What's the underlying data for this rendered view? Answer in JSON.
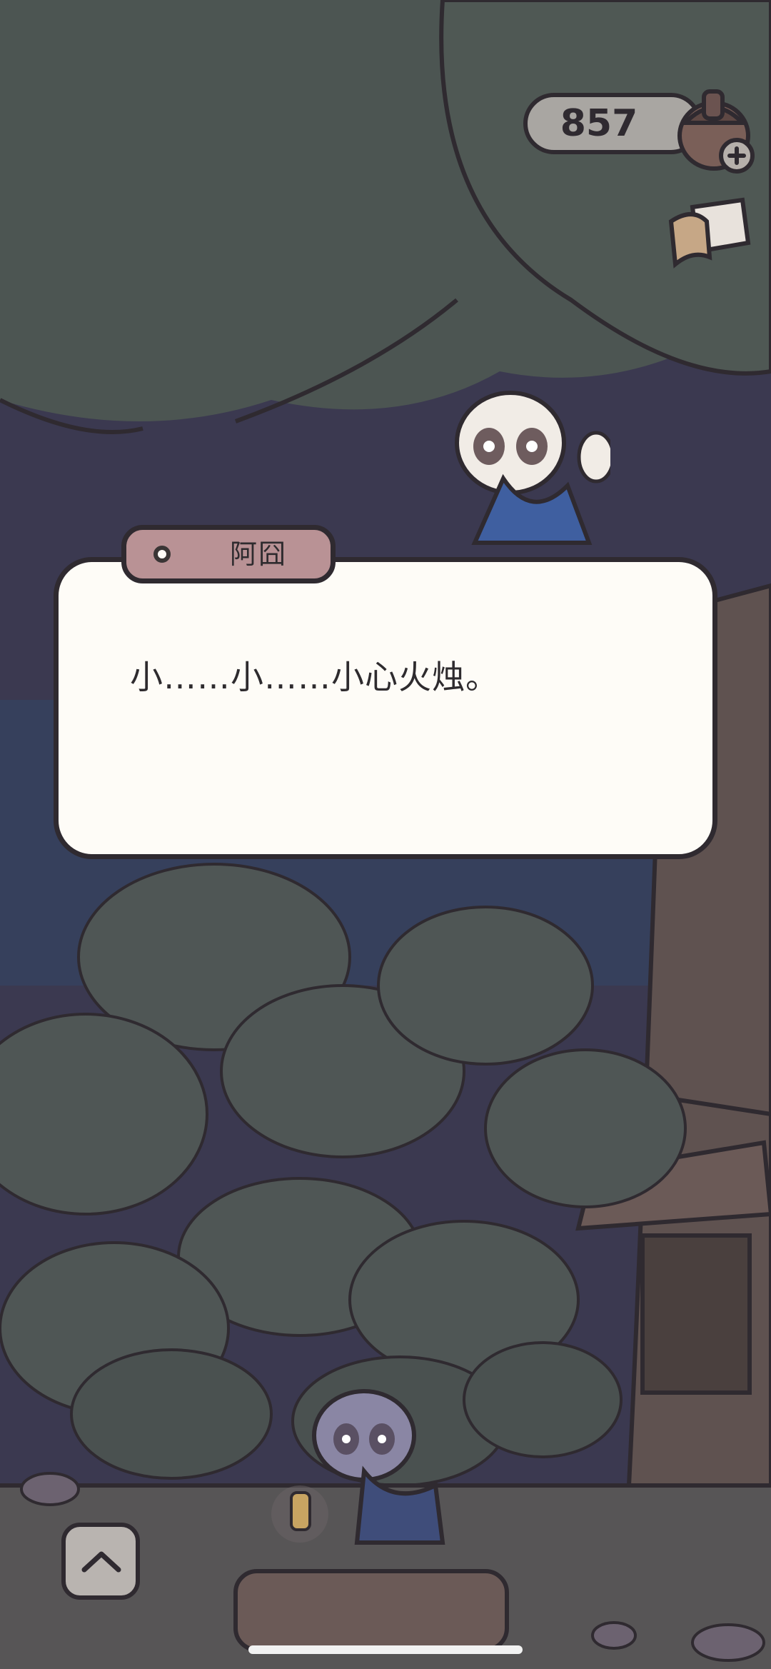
{
  "currency": {
    "value": "857",
    "icon": "acorn-icon",
    "add_icon": "plus-icon"
  },
  "side_item": {
    "icon": "scroll-icon"
  },
  "dialog": {
    "speaker": "阿囧",
    "text": "小……小……小心火烛。"
  },
  "controls": {
    "expand_icon": "chevron-up-icon"
  },
  "colors": {
    "dialog_bg": "#fefcf7",
    "name_tag": "#b99295",
    "outline": "#2f2a30",
    "currency_bg": "#a9a6a2"
  }
}
